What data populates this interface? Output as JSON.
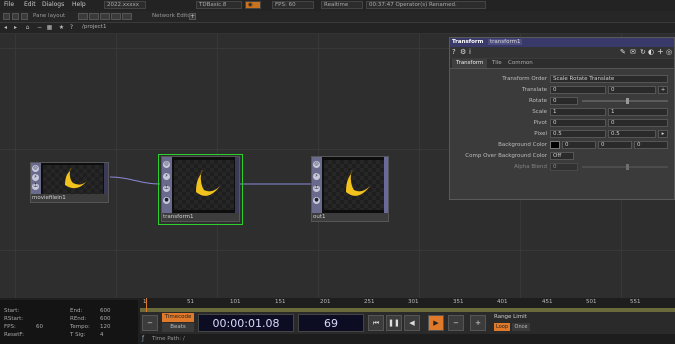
{
  "menubar": {
    "items": [
      "File",
      "Edit",
      "Dialogs",
      "Help"
    ],
    "build": "2022.xxxxx",
    "project": "TDBasic.8",
    "realtime_flag": "Realtime",
    "fps": "FPS: 60",
    "message": "00:37:47 Operator(s) Renamed."
  },
  "panebar": {
    "pane_layout_label": "Pane layout",
    "network_label": "Network Editor"
  },
  "pathbar": {
    "path": "/project1"
  },
  "nodes": [
    {
      "name": "moviefilein1"
    },
    {
      "name": "transform1"
    },
    {
      "name": "out1"
    }
  ],
  "params": {
    "title": "Transform",
    "op_name": "transform1",
    "tabs": [
      "Transform",
      "Tile",
      "Common"
    ],
    "rows": [
      {
        "label": "Transform Order",
        "values": [
          "Scale Rotate Translate"
        ]
      },
      {
        "label": "Translate",
        "values": [
          "0",
          "0"
        ]
      },
      {
        "label": "Rotate",
        "values": [
          "0"
        ]
      },
      {
        "label": "Scale",
        "values": [
          "1",
          "1"
        ]
      },
      {
        "label": "Pivot",
        "values": [
          "0",
          "0"
        ]
      },
      {
        "label": "Pixel",
        "values": [
          "0.5",
          "0.5"
        ]
      },
      {
        "label": "Background Color",
        "values": [
          "0",
          "0",
          "0"
        ]
      },
      {
        "label": "Comp Over Background Color",
        "values": [
          "Off"
        ]
      },
      {
        "label": "Alpha Blend",
        "values": [
          "0"
        ]
      }
    ]
  },
  "info": {
    "rows": [
      {
        "l": "Start:",
        "lv": "",
        "r": "End:",
        "rv": "600"
      },
      {
        "l": "RStart:",
        "lv": "",
        "r": "REnd:",
        "rv": "600"
      },
      {
        "l": "FPS:",
        "lv": "60",
        "r": "Tempo:",
        "rv": "120"
      },
      {
        "l": "ResetF:",
        "lv": "",
        "r": "T Sig:",
        "rv": "4"
      }
    ]
  },
  "ruler": {
    "ticks": [
      "1",
      "51",
      "101",
      "151",
      "201",
      "251",
      "301",
      "351",
      "401",
      "451",
      "501",
      "551"
    ]
  },
  "transport": {
    "timecode_label": "Timecode",
    "beats_label": "Beats",
    "timecode": "00:00:01.08",
    "frame": "69",
    "range_limit": "Range Limit",
    "loop": "Loop",
    "once": "Once"
  },
  "statusbar": {
    "time_path": "Time Path: /"
  },
  "colors": {
    "accent_selected": "#2bd12b",
    "param_header": "#3a3a6a",
    "play_button": "#e07a2a"
  }
}
